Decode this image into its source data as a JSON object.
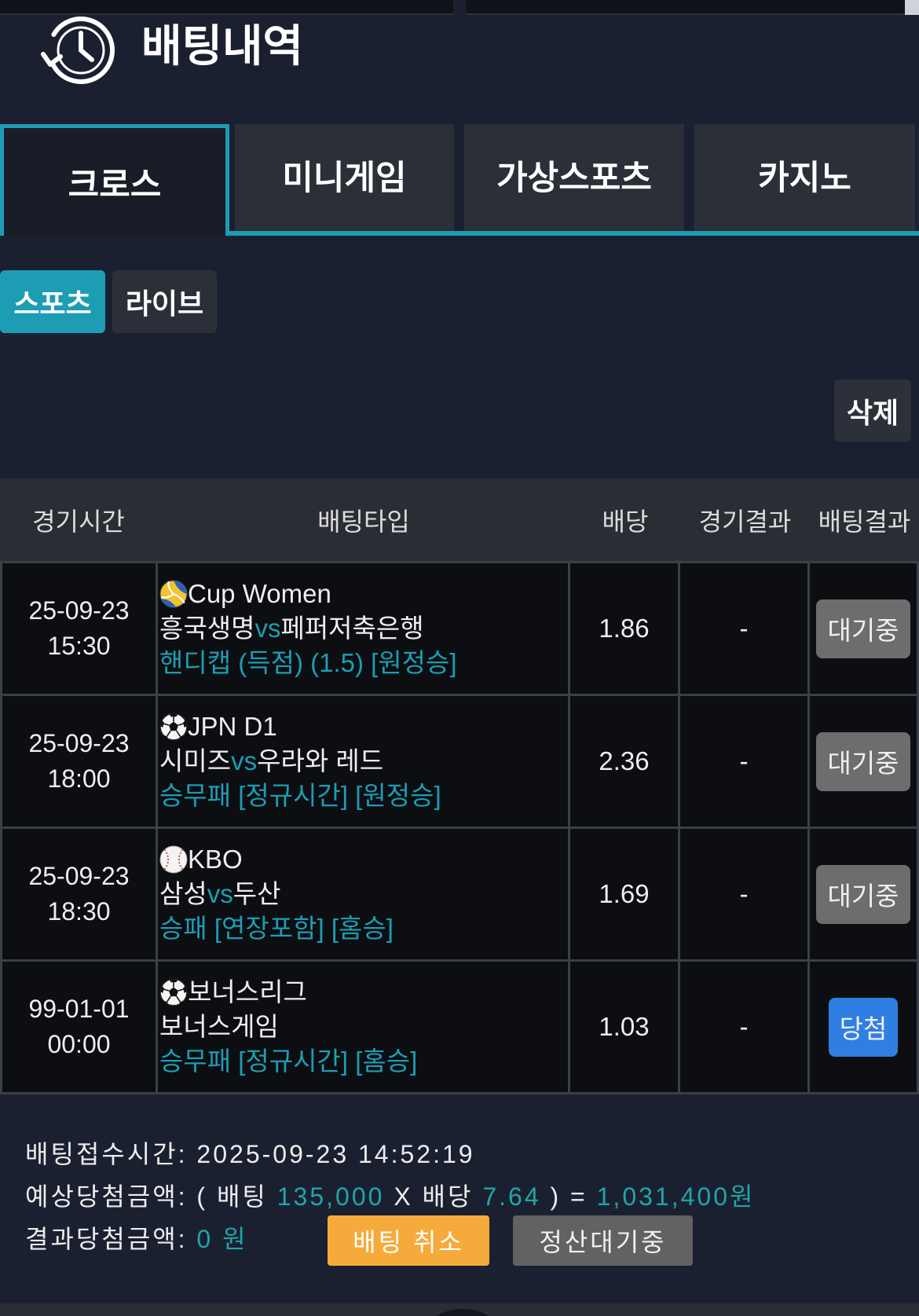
{
  "header": {
    "title": "배팅내역",
    "icon": "history-clock-icon"
  },
  "tabs": [
    {
      "label": "크로스",
      "active": true
    },
    {
      "label": "미니게임",
      "active": false
    },
    {
      "label": "가상스포츠",
      "active": false
    },
    {
      "label": "카지노",
      "active": false
    }
  ],
  "subtabs": [
    {
      "label": "스포츠",
      "active": true
    },
    {
      "label": "라이브",
      "active": false
    }
  ],
  "delete_button": {
    "label": "삭제"
  },
  "table": {
    "headers": [
      "경기시간",
      "배팅타입",
      "배당",
      "경기결과",
      "배팅결과"
    ],
    "rows": [
      {
        "date": "25-09-23",
        "time": "15:30",
        "sport_icon": "volleyball-icon",
        "league": "Cup Women",
        "home": "흥국생명",
        "vs": "vs",
        "away": "페퍼저축은행",
        "market": "핸디캡 (득점) (1.5) [원정승]",
        "odds": "1.86",
        "game_result": "-",
        "bet_result": "대기중",
        "badge_color": "#6d6d6d"
      },
      {
        "date": "25-09-23",
        "time": "18:00",
        "sport_icon": "soccer-ball-icon",
        "league": "JPN D1",
        "home": "시미즈",
        "vs": "vs",
        "away": "우라와 레드",
        "market": "승무패 [정규시간] [원정승]",
        "odds": "2.36",
        "game_result": "-",
        "bet_result": "대기중",
        "badge_color": "#6d6d6d"
      },
      {
        "date": "25-09-23",
        "time": "18:30",
        "sport_icon": "baseball-icon",
        "league": "KBO",
        "home": "삼성",
        "vs": "vs",
        "away": "두산",
        "market": "승패 [연장포함] [홈승]",
        "odds": "1.69",
        "game_result": "-",
        "bet_result": "대기중",
        "badge_color": "#6d6d6d"
      },
      {
        "date": "99-01-01",
        "time": "00:00",
        "sport_icon": "soccer-ball-icon",
        "league": "보너스리그",
        "home": "보너스게임",
        "market": "승무패 [정규시간] [홈승]",
        "odds": "1.03",
        "game_result": "-",
        "bet_result": "당첨",
        "badge_color": "#2f7fe3"
      }
    ]
  },
  "summary": {
    "received_label": "배팅접수시간:",
    "received_time": "2025-09-23 14:52:19",
    "expected_label": "예상당첨금액:",
    "paren_open": "(",
    "bet_label": "배팅",
    "bet_amount": "135,000",
    "multiply": "X",
    "odds_label": "배당",
    "total_odds": "7.64",
    "paren_close": ")",
    "equals": "=",
    "expected_amount": "1,031,400원",
    "result_label": "결과당첨금액:",
    "result_amount": "0 원",
    "cancel_button": "배팅 취소",
    "settle_button": "정산대기중"
  },
  "colors": {
    "background": "#1b2031",
    "accent": "#1c9db3",
    "value_text": "#1fa6a8",
    "tab_inactive": "#2b3038",
    "cancel_button": "#f6aa3c",
    "settle_button": "#626262"
  }
}
